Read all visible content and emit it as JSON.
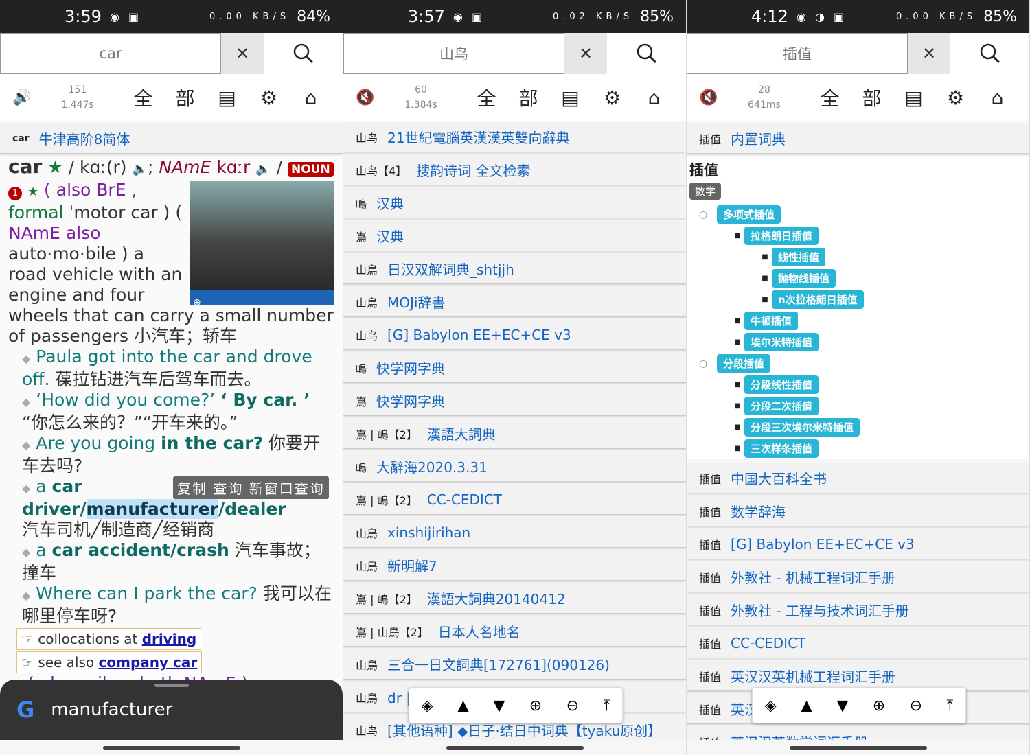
{
  "p1": {
    "status": {
      "time": "3:59",
      "speed": "0.00 KB/S",
      "battery": "84%"
    },
    "search": {
      "value": "car"
    },
    "stats": {
      "count": "151",
      "time": "1.447s"
    },
    "tools": {
      "all": "全",
      "part": "部"
    },
    "dict_row": {
      "word": "car",
      "dict": "牛津高阶8简体"
    },
    "entry": {
      "headword": "car",
      "pron_br": "/ kɑː(r)",
      "namE": "NAmE",
      "pron_us": "kɑːr",
      "noun": "NOUN",
      "sense1_a": "( also BrE ,",
      "sense1_formal": "formal",
      "sense1_b": "ˈmotor car ) (",
      "sense1_namE": "NAmE also",
      "sense1_c": "auto·mo·bile )  a road vehicle with an engine and four wheels that can carry a small number of passengers 小汽车；轿车",
      "ex1_en": "Paula got into the car and drove off.",
      "ex1_zh": "葆拉钻进汽车后驾车而去。",
      "ex2_en_a": "‘How did you come?’",
      "ex2_en_b": "‘ By car. ’",
      "ex2_zh": "“你怎么来的？”“开车来的。”",
      "ex3_en_a": "Are you going",
      "ex3_en_b": "in the car?",
      "ex3_zh": "你要开车去吗?",
      "ex4_a": "a",
      "ex4_b": "car driver/",
      "ex4_sel": "manufacturer",
      "ex4_c": "/dealer",
      "ex4_zh": "汽车司机╱制造商╱经销商",
      "ex5_a": "a",
      "ex5_b": "car accident/crash",
      "ex5_zh": "汽车事故；撞车",
      "ex6_en": "Where can I park the car?",
      "ex6_zh": "我可以在哪里停车呀?",
      "coll1_text": "collocations at",
      "coll1_link": "driving",
      "coll2_text": "see also",
      "coll2_link": "company car",
      "cut_line": "( also railcar both NAmE ) a"
    },
    "popup": {
      "copy": "复制",
      "lookup": "查询",
      "newwin": "新窗口查询"
    },
    "google": {
      "logo": "G",
      "query": "manufacturer"
    }
  },
  "p2": {
    "status": {
      "time": "3:57",
      "speed": "0.02 KB/S",
      "battery": "85%"
    },
    "search": {
      "placeholder": "山鸟"
    },
    "stats": {
      "count": "60",
      "time": "1.384s"
    },
    "rows": [
      {
        "word": "山鸟",
        "dict": "21世紀電腦英漢漢英雙向辭典"
      },
      {
        "word": "山鸟【4】",
        "dict": "搜韵诗词 全文检索"
      },
      {
        "word": "嶋",
        "dict": "汉典"
      },
      {
        "word": "嶌",
        "dict": "汉典"
      },
      {
        "word": "山鳥",
        "dict": "日汉双解词典_shtjjh"
      },
      {
        "word": "山鳥",
        "dict": "MOJi辞書"
      },
      {
        "word": "山鸟",
        "dict": "[G] Babylon EE+EC+CE v3"
      },
      {
        "word": "嶋",
        "dict": "快学网字典"
      },
      {
        "word": "嶌",
        "dict": "快学网字典"
      },
      {
        "word": "嶌 | 嶋【2】",
        "dict": "漢語大詞典"
      },
      {
        "word": "嶋",
        "dict": "大辭海2020.3.31"
      },
      {
        "word": "嶌 | 嶋【2】",
        "dict": "CC-CEDICT"
      },
      {
        "word": "山鳥",
        "dict": "xinshijirihan"
      },
      {
        "word": "山鳥",
        "dict": "新明解7"
      },
      {
        "word": "嶌 | 嶋【2】",
        "dict": "漢語大詞典20140412"
      },
      {
        "word": "嶌 | 山鳥【2】",
        "dict": "日本人名地名"
      },
      {
        "word": "山鳥",
        "dict": "三合一日文詞典[172761](090126)"
      },
      {
        "word": "山鳥",
        "dict": "dr | 0.0日漢字典"
      },
      {
        "word": "山鸟",
        "dict": "[其他语种] ◆日子·结日中词典【tyaku原创】"
      }
    ]
  },
  "p3": {
    "status": {
      "time": "4:12",
      "speed": "0.00 KB/S",
      "battery": "85%"
    },
    "search": {
      "placeholder": "插值"
    },
    "stats": {
      "count": "28",
      "time": "641ms"
    },
    "first_row": {
      "word": "插值",
      "dict": "内置词典"
    },
    "tree": {
      "title": "插值",
      "tag": "数学",
      "n1": "多项式插值",
      "n1_1": "拉格朗日插值",
      "n1_1_1": "线性插值",
      "n1_1_2": "抛物线插值",
      "n1_1_3": "n次拉格朗日插值",
      "n1_2": "牛顿插值",
      "n1_3": "埃尔米特插值",
      "n2": "分段插值",
      "n2_1": "分段线性插值",
      "n2_2": "分段二次插值",
      "n2_3": "分段三次埃尔米特插值",
      "n2_4": "三次样条插值"
    },
    "rows": [
      {
        "word": "插值",
        "dict": "中国大百科全书"
      },
      {
        "word": "插值",
        "dict": "数学辞海"
      },
      {
        "word": "插值",
        "dict": "[G] Babylon EE+EC+CE v3"
      },
      {
        "word": "插值",
        "dict": "外教社 - 机械工程词汇手册"
      },
      {
        "word": "插值",
        "dict": "外教社 - 工程与技术词汇手册"
      },
      {
        "word": "插值",
        "dict": "CC-CEDICT"
      },
      {
        "word": "插值",
        "dict": "英汉汉英机械工程词汇手册"
      },
      {
        "word": "插值",
        "dict": "英汉汉英..."
      },
      {
        "word": "插值",
        "dict": "英汉汉英数学词汇手册"
      }
    ]
  }
}
